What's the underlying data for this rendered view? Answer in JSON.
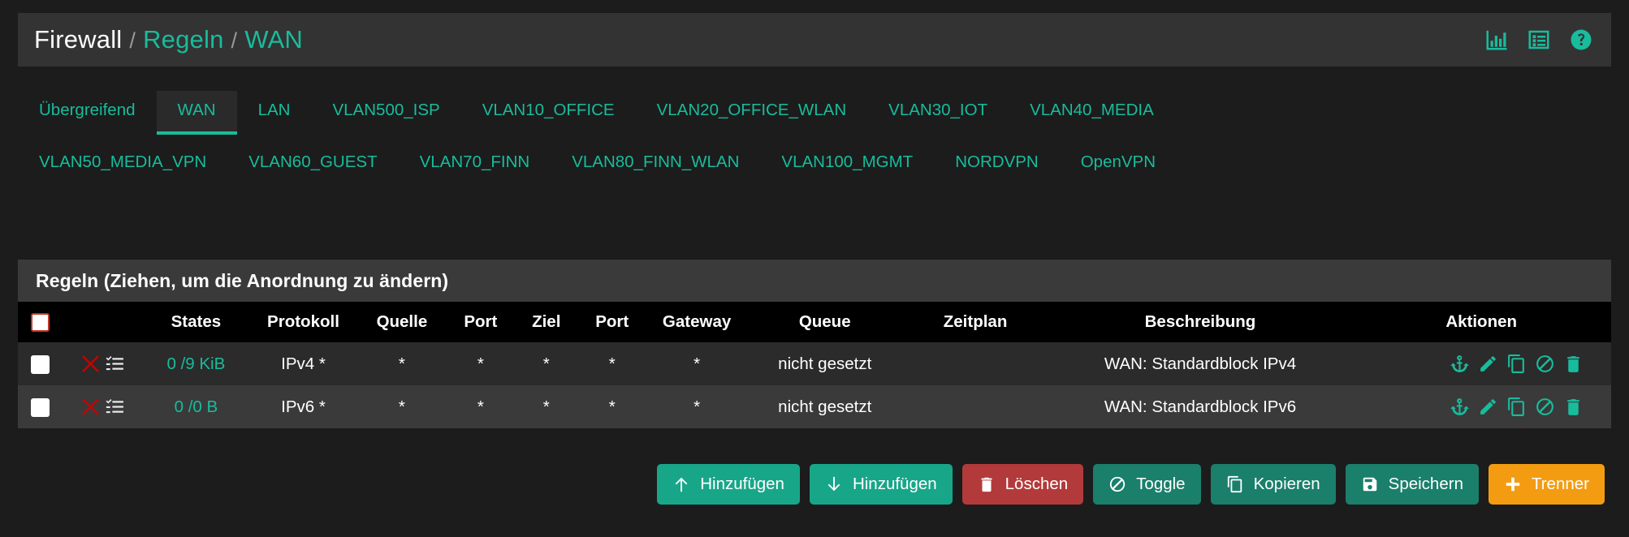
{
  "header": {
    "breadcrumb": {
      "root": "Firewall",
      "sep": "/",
      "section": "Regeln",
      "current": "WAN"
    },
    "icons": [
      {
        "name": "chart-bar-icon",
        "label": "Statistik"
      },
      {
        "name": "table-list-icon",
        "label": "Tabelle"
      },
      {
        "name": "help-circle-icon",
        "label": "Hilfe"
      }
    ]
  },
  "tabs": {
    "active": "WAN",
    "row1": [
      "Übergreifend",
      "WAN",
      "LAN",
      "VLAN500_ISP",
      "VLAN10_OFFICE",
      "VLAN20_OFFICE_WLAN",
      "VLAN30_IOT",
      "VLAN40_MEDIA"
    ],
    "row2": [
      "VLAN50_MEDIA_VPN",
      "VLAN60_GUEST",
      "VLAN70_FINN",
      "VLAN80_FINN_WLAN",
      "VLAN100_MGMT",
      "NORDVPN",
      "OpenVPN"
    ]
  },
  "panel": {
    "heading": "Regeln (Ziehen, um die Anordnung zu ändern)",
    "columns": {
      "checkbox": "",
      "icons": "",
      "states": "States",
      "protocol": "Protokoll",
      "source": "Quelle",
      "source_port": "Port",
      "destination": "Ziel",
      "destination_port": "Port",
      "gateway": "Gateway",
      "queue": "Queue",
      "schedule": "Zeitplan",
      "description": "Beschreibung",
      "actions": "Aktionen"
    },
    "rows": [
      {
        "states": "0 /9 KiB",
        "protocol": "IPv4 *",
        "source": "*",
        "source_port": "*",
        "destination": "*",
        "destination_port": "*",
        "gateway": "*",
        "queue": "nicht gesetzt",
        "schedule": "",
        "description": "WAN: Standardblock IPv4",
        "status_icons": [
          "block-x-icon",
          "states-list-icon"
        ],
        "action_icons": [
          "anchor-icon",
          "edit-pencil-icon",
          "copy-icon",
          "disable-ban-icon",
          "delete-trash-icon"
        ]
      },
      {
        "states": "0 /0 B",
        "protocol": "IPv6 *",
        "source": "*",
        "source_port": "*",
        "destination": "*",
        "destination_port": "*",
        "gateway": "*",
        "queue": "nicht gesetzt",
        "schedule": "",
        "description": "WAN: Standardblock IPv6",
        "status_icons": [
          "block-x-icon",
          "states-list-icon"
        ],
        "action_icons": [
          "anchor-icon",
          "edit-pencil-icon",
          "copy-icon",
          "disable-ban-icon",
          "delete-trash-icon"
        ]
      }
    ]
  },
  "buttons": [
    {
      "label": "Hinzufügen",
      "icon": "arrow-up-icon",
      "style": "teal"
    },
    {
      "label": "Hinzufügen",
      "icon": "arrow-down-icon",
      "style": "teal"
    },
    {
      "label": "Löschen",
      "icon": "trash-icon",
      "style": "red"
    },
    {
      "label": "Toggle",
      "icon": "ban-icon",
      "style": "teal-dark"
    },
    {
      "label": "Kopieren",
      "icon": "copy-icon",
      "style": "teal-dark"
    },
    {
      "label": "Speichern",
      "icon": "save-icon",
      "style": "teal-dark"
    },
    {
      "label": "Trenner",
      "icon": "plus-icon",
      "style": "orange"
    }
  ],
  "colors": {
    "accent_teal": "#18bc9c",
    "button_teal": "#18a689",
    "button_teal_dark": "#1a7f6b",
    "danger_red": "#b33a3a",
    "block_red": "#cc0000",
    "orange": "#f39c12",
    "page_bg": "#1c1c1c",
    "header_bg": "#333333",
    "panel_heading_bg": "#3a3a3a",
    "table_header_bg": "#000000",
    "row_odd_bg": "#2b2b2b",
    "row_even_bg": "#3a3a3a"
  }
}
